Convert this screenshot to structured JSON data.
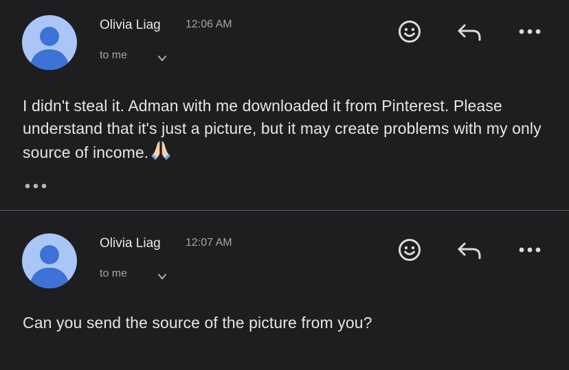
{
  "messages": [
    {
      "sender": "Olivia Liag",
      "time": "12:06 AM",
      "recipient": "to me",
      "body": "I didn't steal it. Adman with me downloaded it from Pinterest. Please understand that it's just a picture, but it may create problems with my only source of income.",
      "body_emoji": "folded-hands-emoji",
      "trimmed_content": true
    },
    {
      "sender": "Olivia Liag",
      "time": "12:07 AM",
      "recipient": "to me",
      "body": "Can you send the source of the picture from you?"
    }
  ],
  "icons": {
    "emoji": "smiley-face-icon",
    "reply": "reply-arrow-icon",
    "more": "more-options-icon",
    "expand": "chevron-down-icon"
  },
  "colors": {
    "background": "#1e1e20",
    "avatar_bg": "#a9c6f6",
    "avatar_fg": "#3d72d6",
    "text": "#e6e6e6",
    "muted": "#a6a6a9",
    "divider": "#5f6063"
  }
}
